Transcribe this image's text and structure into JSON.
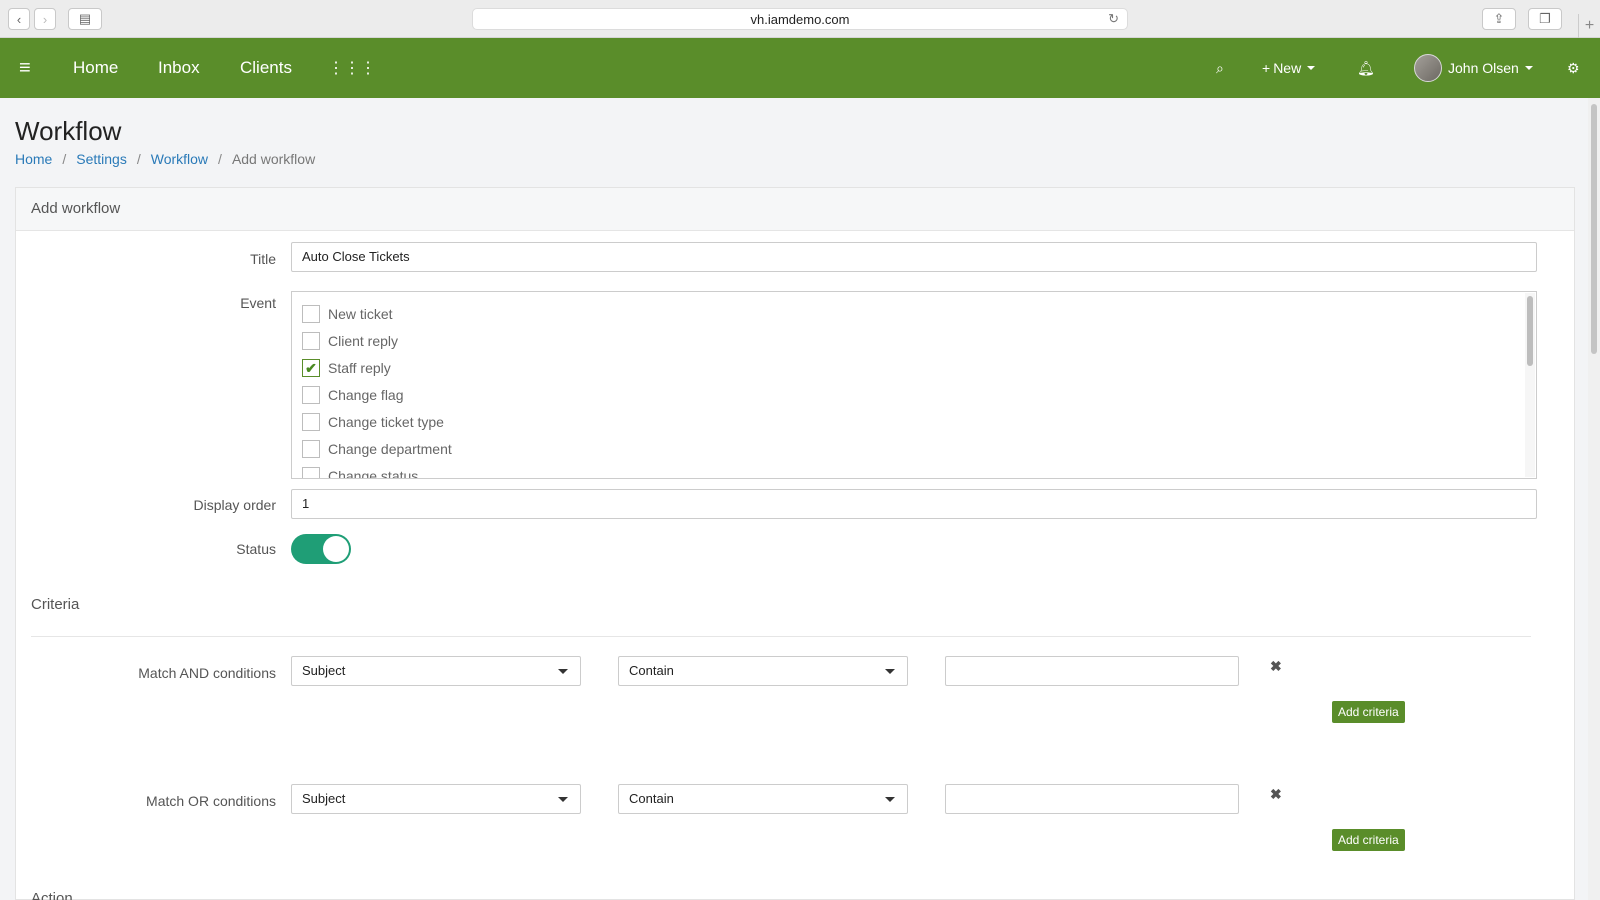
{
  "browser": {
    "url": "vh.iamdemo.com"
  },
  "nav": {
    "items": [
      "Home",
      "Inbox",
      "Clients"
    ],
    "new_label": "New",
    "user_name": "John Olsen"
  },
  "page": {
    "title": "Workflow",
    "breadcrumb": [
      "Home",
      "Settings",
      "Workflow",
      "Add workflow"
    ]
  },
  "panel": {
    "heading": "Add workflow"
  },
  "form": {
    "title_label": "Title",
    "title_value": "Auto Close Tickets",
    "event_label": "Event",
    "events": [
      {
        "label": "New ticket",
        "checked": false
      },
      {
        "label": "Client reply",
        "checked": false
      },
      {
        "label": "Staff reply",
        "checked": true
      },
      {
        "label": "Change flag",
        "checked": false
      },
      {
        "label": "Change ticket type",
        "checked": false
      },
      {
        "label": "Change department",
        "checked": false
      },
      {
        "label": "Change status",
        "checked": false
      }
    ],
    "display_order_label": "Display order",
    "display_order_value": "1",
    "status_label": "Status",
    "status_on": true
  },
  "criteria": {
    "heading": "Criteria",
    "and_label": "Match AND conditions",
    "or_label": "Match OR conditions",
    "field_value": "Subject",
    "operator_value": "Contain",
    "text_value": "",
    "add_label": "Add criteria"
  },
  "action": {
    "heading": "Action"
  },
  "colors": {
    "nav_green": "#5a8d2a",
    "toggle_on": "#1f9e76",
    "link": "#2a7ab8"
  }
}
